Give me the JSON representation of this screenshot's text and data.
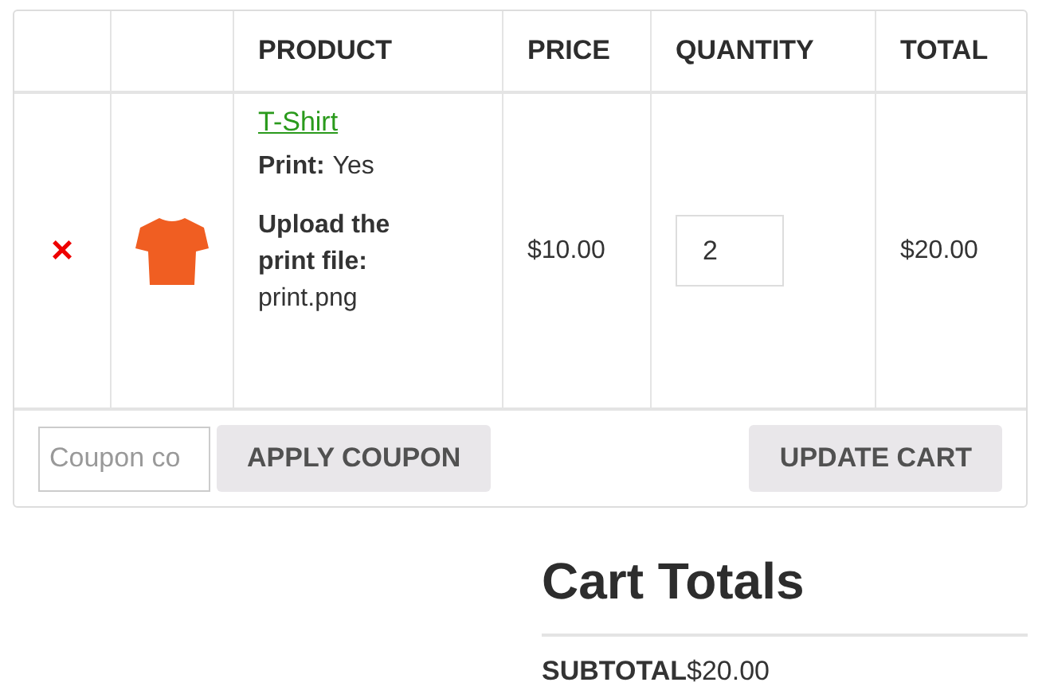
{
  "cart_table": {
    "columns": [
      "PRODUCT",
      "PRICE",
      "QUANTITY",
      "TOTAL"
    ],
    "rows": [
      {
        "remove": "×",
        "product": "T-Shirt",
        "meta": [
          {
            "kind": "inline",
            "label": "Print:",
            "value": "Yes"
          },
          {
            "kind": "stacked",
            "label": "Upload the print file:",
            "value": "print.png"
          }
        ],
        "price": "$10.00",
        "quantity": "2",
        "total": "$20.00"
      }
    ]
  },
  "actions": {
    "coupon": {
      "placeholder": "Coupon co"
    },
    "apply_button": "APPLY COUPON",
    "update_button": "UPDATE CART"
  },
  "cart_totals": {
    "title": "Cart Totals",
    "rows": [
      {
        "label": "SUBTOTAL",
        "value": "$20.00"
      }
    ]
  }
}
